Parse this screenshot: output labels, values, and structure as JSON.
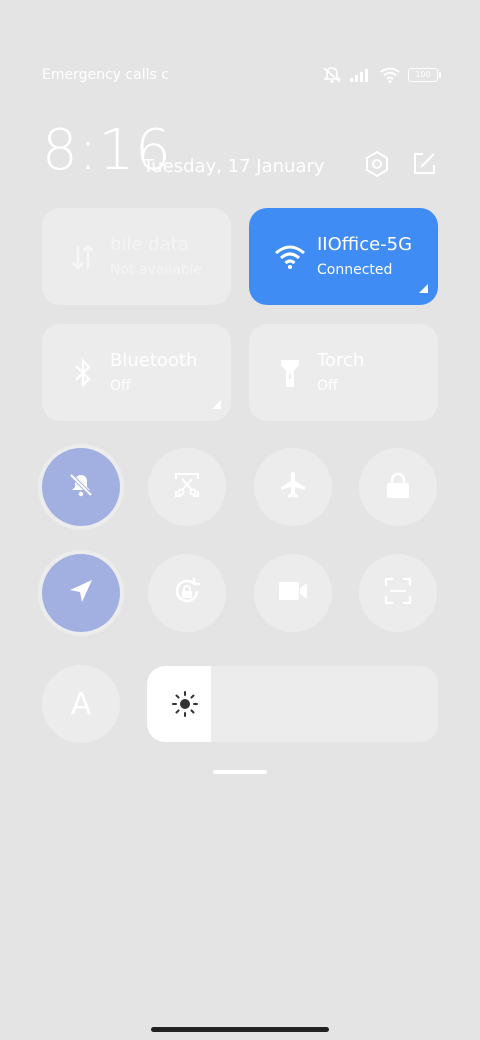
{
  "status_bar": {
    "carrier": "Emergency calls c",
    "battery": "100",
    "icons": [
      "mute-icon",
      "signal-icon",
      "wifi-icon",
      "battery-icon"
    ]
  },
  "header": {
    "time": "8:16",
    "date": "Tuesday, 17 January",
    "icons": [
      "settings-icon",
      "edit-icon"
    ]
  },
  "tiles": [
    {
      "name": "bile data",
      "status": "Not available",
      "icon": "mobile-data-icon",
      "active": false
    },
    {
      "name": "IIOffice-5G",
      "status": "Connected",
      "icon": "wifi-icon",
      "active": true
    },
    {
      "name": "Bluetooth",
      "status": "Off",
      "icon": "bluetooth-icon",
      "active": false
    },
    {
      "name": "Torch",
      "status": "Off",
      "icon": "torch-icon",
      "active": false
    }
  ],
  "toggles": [
    {
      "icon": "silent-bell-icon",
      "active": true
    },
    {
      "icon": "screenshot-icon",
      "active": false
    },
    {
      "icon": "airplane-icon",
      "active": false
    },
    {
      "icon": "lock-icon",
      "active": false
    },
    {
      "icon": "location-icon",
      "active": true
    },
    {
      "icon": "rotation-lock-icon",
      "active": false
    },
    {
      "icon": "video-icon",
      "active": false
    },
    {
      "icon": "scan-icon",
      "active": false
    }
  ],
  "font_button": {
    "label": "A"
  },
  "brightness": {
    "level_fraction": 0.22
  },
  "colors": {
    "accent": "#3f8cf5",
    "active_toggle": "#a2b0e1",
    "background": "#e4e4e4"
  }
}
